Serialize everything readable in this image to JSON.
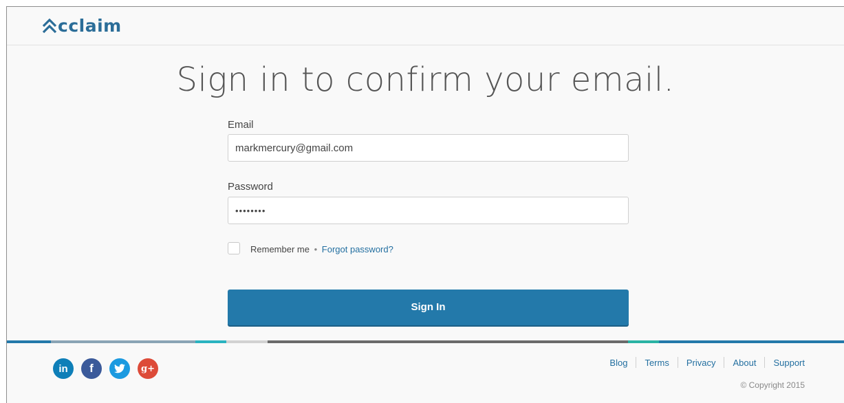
{
  "brand": {
    "name": "cclaim",
    "color": "#2b6d98"
  },
  "page_title": "Sign in to confirm your email.",
  "form": {
    "email_label": "Email",
    "email_value": "markmercury@gmail.com",
    "password_label": "Password",
    "password_value": "••••••••",
    "remember_label": "Remember me",
    "bullet": "•",
    "forgot_label": "Forgot password?",
    "signin_label": "Sign In"
  },
  "footer": {
    "social": [
      {
        "name": "linkedin",
        "glyph": "in",
        "color": "#0e7fb8"
      },
      {
        "name": "facebook",
        "glyph": "f",
        "color": "#3b5a9a"
      },
      {
        "name": "twitter",
        "glyph": "t",
        "color": "#1c9ae0"
      },
      {
        "name": "google-plus",
        "glyph": "g+",
        "color": "#dd4b39"
      }
    ],
    "links": [
      "Blog",
      "Terms",
      "Privacy",
      "About",
      "Support"
    ],
    "copyright": "© Copyright 2015"
  },
  "colors": {
    "accent": "#2379aa",
    "link": "#236fa0",
    "stripe": [
      "#2379aa",
      "#8aa4b5",
      "#2ab3c0",
      "#d2d2d2",
      "#6b6b6b",
      "#2ab3a4",
      "#2379aa"
    ]
  }
}
